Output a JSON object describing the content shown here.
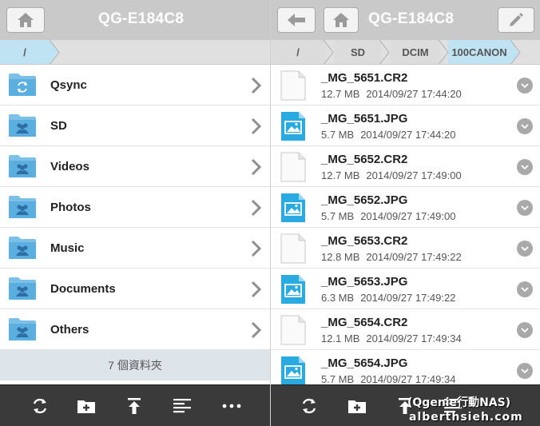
{
  "left": {
    "title": "QG-E184C8",
    "breadcrumb": [
      "/"
    ],
    "folders": [
      {
        "name": "Qsync",
        "icon": "qsync-folder-icon"
      },
      {
        "name": "SD",
        "icon": "shared-folder-icon"
      },
      {
        "name": "Videos",
        "icon": "shared-folder-icon"
      },
      {
        "name": "Photos",
        "icon": "shared-folder-icon"
      },
      {
        "name": "Music",
        "icon": "shared-folder-icon"
      },
      {
        "name": "Documents",
        "icon": "shared-folder-icon"
      },
      {
        "name": "Others",
        "icon": "shared-folder-icon"
      }
    ],
    "folder_count": "7 個資料夾",
    "toolbar": [
      "refresh-icon",
      "new-folder-icon",
      "upload-icon",
      "sort-icon",
      "more-icon"
    ]
  },
  "right": {
    "title": "QG-E184C8",
    "breadcrumb": [
      "/",
      "SD",
      "DCIM",
      "100CANON"
    ],
    "files": [
      {
        "name": "_MG_5651.CR2",
        "size": "12.7 MB",
        "date": "2014/09/27 17:44:20",
        "type": "raw"
      },
      {
        "name": "_MG_5651.JPG",
        "size": "5.7 MB",
        "date": "2014/09/27 17:44:20",
        "type": "image"
      },
      {
        "name": "_MG_5652.CR2",
        "size": "12.7 MB",
        "date": "2014/09/27 17:49:00",
        "type": "raw"
      },
      {
        "name": "_MG_5652.JPG",
        "size": "5.7 MB",
        "date": "2014/09/27 17:49:00",
        "type": "image"
      },
      {
        "name": "_MG_5653.CR2",
        "size": "12.8 MB",
        "date": "2014/09/27 17:49:22",
        "type": "raw"
      },
      {
        "name": "_MG_5653.JPG",
        "size": "6.3 MB",
        "date": "2014/09/27 17:49:22",
        "type": "image"
      },
      {
        "name": "_MG_5654.CR2",
        "size": "12.1 MB",
        "date": "2014/09/27 17:49:34",
        "type": "raw"
      },
      {
        "name": "_MG_5654.JPG",
        "size": "5.7 MB",
        "date": "2014/09/27 17:49:34",
        "type": "image"
      }
    ],
    "toolbar": [
      "refresh-icon",
      "new-folder-icon",
      "upload-icon",
      "sort-icon"
    ]
  },
  "watermark": {
    "line1": "(Qgenie行動NAS)",
    "line2": "alberthsieh.com"
  },
  "colors": {
    "titlebar": "#c9c9c9",
    "breadcrumb_active": "#bfe3f3",
    "folder_blue": "#5aaee0",
    "image_blue": "#29abe2",
    "toolbar": "#3a3a3a"
  }
}
